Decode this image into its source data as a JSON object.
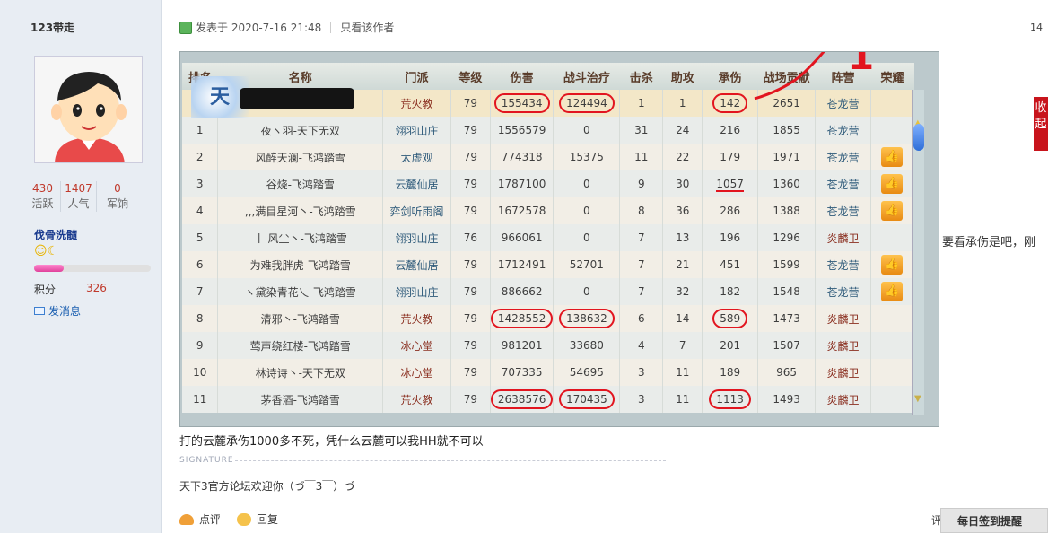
{
  "user": {
    "name": "123带走",
    "stats": [
      {
        "value": "430",
        "label": "活跃"
      },
      {
        "value": "1407",
        "label": "人气"
      },
      {
        "value": "0",
        "label": "军饷"
      }
    ],
    "group": "伐骨洗髓",
    "group_icons": "☺☾",
    "level_fraction": 0.25,
    "credit_label": "积分",
    "credit_value": "326",
    "send_message": "发消息"
  },
  "post": {
    "posted_label": "发表于 2020-7-16 21:48",
    "author_only": "只看该作者",
    "floor": "14",
    "body": "打的云麓承伤1000多不死，凭什么云麓可以我HH就不可以",
    "signature_title": "SIGNATURE",
    "signature_text": "天下3官方论坛欢迎你（づ￣3￣）づ",
    "action_comment": "点评",
    "action_reply": "回复",
    "report": "评",
    "side_quote": "要看承伤是吧，刚",
    "fav_tab": "收起",
    "checkin": "每日签到提醒"
  },
  "game_table": {
    "logo_text": "天",
    "annotation_mark": "1",
    "headers": [
      "排名",
      "名称",
      "门派",
      "等级",
      "伤害",
      "战斗治疗",
      "击杀",
      "助攻",
      "承伤",
      "战场贡献",
      "阵营",
      "荣耀"
    ],
    "rows": [
      {
        "rank": "",
        "name": "",
        "sect": "荒火教",
        "level": "79",
        "damage": "155434",
        "heal": "124494",
        "kills": "1",
        "assists": "1",
        "taken": "142",
        "contrib": "2651",
        "camp": "苍龙营",
        "honor": false,
        "marked": true
      },
      {
        "rank": "1",
        "name": "夜ヽ羽-天下无双",
        "sect": "翎羽山庄",
        "level": "79",
        "damage": "1556579",
        "heal": "0",
        "kills": "31",
        "assists": "24",
        "taken": "216",
        "contrib": "1855",
        "camp": "苍龙营",
        "honor": false,
        "marked": false
      },
      {
        "rank": "2",
        "name": "风醉天澜-飞鸿踏雪",
        "sect": "太虚观",
        "level": "79",
        "damage": "774318",
        "heal": "15375",
        "kills": "11",
        "assists": "22",
        "taken": "179",
        "contrib": "1971",
        "camp": "苍龙营",
        "honor": true,
        "marked": false
      },
      {
        "rank": "3",
        "name": "谷烧-飞鸿踏雪",
        "sect": "云麓仙居",
        "level": "79",
        "damage": "1787100",
        "heal": "0",
        "kills": "9",
        "assists": "30",
        "taken": "1057",
        "contrib": "1360",
        "camp": "苍龙营",
        "honor": true,
        "marked": false,
        "underline": true
      },
      {
        "rank": "4",
        "name": ",,,满目星河丶-飞鸿踏雪",
        "sect": "弈剑听雨阁",
        "level": "79",
        "damage": "1672578",
        "heal": "0",
        "kills": "8",
        "assists": "36",
        "taken": "286",
        "contrib": "1388",
        "camp": "苍龙营",
        "honor": true,
        "marked": false
      },
      {
        "rank": "5",
        "name": "丨 风尘丶-飞鸿踏雪",
        "sect": "翎羽山庄",
        "level": "76",
        "damage": "966061",
        "heal": "0",
        "kills": "7",
        "assists": "13",
        "taken": "196",
        "contrib": "1296",
        "camp": "炎麟卫",
        "honor": false,
        "marked": false
      },
      {
        "rank": "6",
        "name": "为难我胖虎-飞鸿踏雪",
        "sect": "云麓仙居",
        "level": "79",
        "damage": "1712491",
        "heal": "52701",
        "kills": "7",
        "assists": "21",
        "taken": "451",
        "contrib": "1599",
        "camp": "苍龙营",
        "honor": true,
        "marked": false
      },
      {
        "rank": "7",
        "name": "ヽ黛染青花乀-飞鸿踏雪",
        "sect": "翎羽山庄",
        "level": "79",
        "damage": "886662",
        "heal": "0",
        "kills": "7",
        "assists": "32",
        "taken": "182",
        "contrib": "1548",
        "camp": "苍龙营",
        "honor": true,
        "marked": false
      },
      {
        "rank": "8",
        "name": "清邪丶-飞鸿踏雪",
        "sect": "荒火教",
        "level": "79",
        "damage": "1428552",
        "heal": "138632",
        "kills": "6",
        "assists": "14",
        "taken": "589",
        "contrib": "1473",
        "camp": "炎麟卫",
        "honor": false,
        "marked": true
      },
      {
        "rank": "9",
        "name": "莺声绕红楼-飞鸿踏雪",
        "sect": "冰心堂",
        "level": "79",
        "damage": "981201",
        "heal": "33680",
        "kills": "4",
        "assists": "7",
        "taken": "201",
        "contrib": "1507",
        "camp": "炎麟卫",
        "honor": false,
        "marked": false
      },
      {
        "rank": "10",
        "name": "林诗诗丶-天下无双",
        "sect": "冰心堂",
        "level": "79",
        "damage": "707335",
        "heal": "54695",
        "kills": "3",
        "assists": "11",
        "taken": "189",
        "contrib": "965",
        "camp": "炎麟卫",
        "honor": false,
        "marked": false
      },
      {
        "rank": "11",
        "name": "茅香酒-飞鸿踏雪",
        "sect": "荒火教",
        "level": "79",
        "damage": "2638576",
        "heal": "170435",
        "kills": "3",
        "assists": "11",
        "taken": "1113",
        "contrib": "1493",
        "camp": "炎麟卫",
        "honor": false,
        "marked": true
      }
    ]
  }
}
